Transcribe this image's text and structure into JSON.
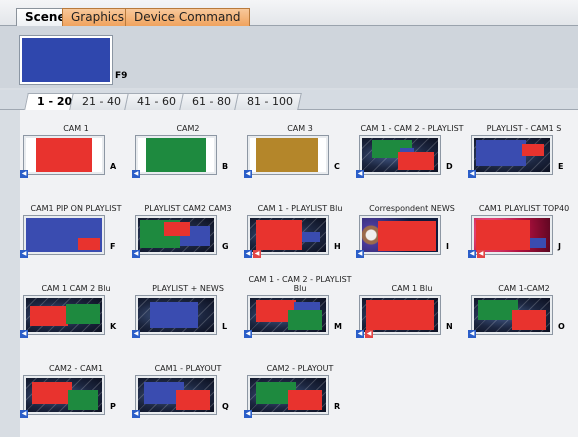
{
  "tabs": [
    {
      "label": "Scene",
      "active": true
    },
    {
      "label": "Graphics",
      "active": false
    },
    {
      "label": "Device Command",
      "active": false
    }
  ],
  "function_thumb": {
    "key": "F9",
    "color": "#2f47ad"
  },
  "page_tabs": [
    {
      "label": "1 - 20",
      "active": true
    },
    {
      "label": "21 - 40",
      "active": false
    },
    {
      "label": "41 - 60",
      "active": false
    },
    {
      "label": "61 - 80",
      "active": false
    },
    {
      "label": "81 - 100",
      "active": false
    }
  ],
  "colors": {
    "red": "#e8332e",
    "green": "#1e8a3f",
    "gold": "#b4862a",
    "blue": "#3a4cb0",
    "audio": "#2b5ec8"
  },
  "scenes": [
    {
      "title": "CAM 1",
      "key": "A"
    },
    {
      "title": "CAM2",
      "key": "B"
    },
    {
      "title": "CAM 3",
      "key": "C"
    },
    {
      "title": "CAM 1 - CAM 2 - PLAYLIST",
      "key": "D"
    },
    {
      "title": "PLAYLIST - CAM1 S",
      "key": "E"
    },
    {
      "title": "CAM1 PIP ON PLAYLIST",
      "key": "F"
    },
    {
      "title": "PLAYLIST CAM2 CAM3",
      "key": "G"
    },
    {
      "title": "CAM 1 - PLAYLIST Blu",
      "key": "H"
    },
    {
      "title": "Correspondent NEWS",
      "key": "I"
    },
    {
      "title": "CAM1 PLAYLIST TOP40",
      "key": "J"
    },
    {
      "title": "CAM 1  CAM 2 Blu",
      "key": "K"
    },
    {
      "title": "PLAYLIST + NEWS",
      "key": "L"
    },
    {
      "title": "CAM 1 - CAM 2 - PLAYLIST Blu",
      "key": "M"
    },
    {
      "title": "CAM 1 Blu",
      "key": "N"
    },
    {
      "title": "CAM 1-CAM2",
      "key": "O"
    },
    {
      "title": "CAM2 - CAM1",
      "key": "P"
    },
    {
      "title": "CAM1 - PLAYOUT",
      "key": "Q"
    },
    {
      "title": "CAM2 - PLAYOUT",
      "key": "R"
    }
  ]
}
